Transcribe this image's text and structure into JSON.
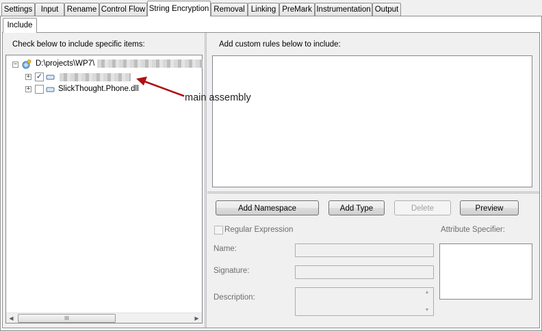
{
  "tabs": [
    "Settings",
    "Input",
    "Rename",
    "Control Flow",
    "String Encryption",
    "Removal",
    "Linking",
    "PreMark",
    "Instrumentation",
    "Output"
  ],
  "active_tab": "String Encryption",
  "subtab": "Include",
  "left_panel": {
    "heading": "Check below to include specific items:",
    "tree": {
      "root_label": "D:\\projects\\WP7\\",
      "children": [
        {
          "label": "",
          "checked": true,
          "checkmark": "✓"
        },
        {
          "label": "SlickThought.Phone.dll",
          "checked": false,
          "checkmark": ""
        }
      ]
    },
    "scroll_grip": "III"
  },
  "right_panel": {
    "heading": "Add custom rules below to include:",
    "buttons": {
      "add_namespace": "Add Namespace",
      "add_type": "Add Type",
      "delete": "Delete",
      "preview": "Preview"
    },
    "regex_label": "Regular Expression",
    "name_label": "Name:",
    "signature_label": "Signature:",
    "description_label": "Description:",
    "attribute_label": "Attribute Specifier:"
  },
  "annotation": {
    "text": "main assembly",
    "color": "#b01010"
  }
}
